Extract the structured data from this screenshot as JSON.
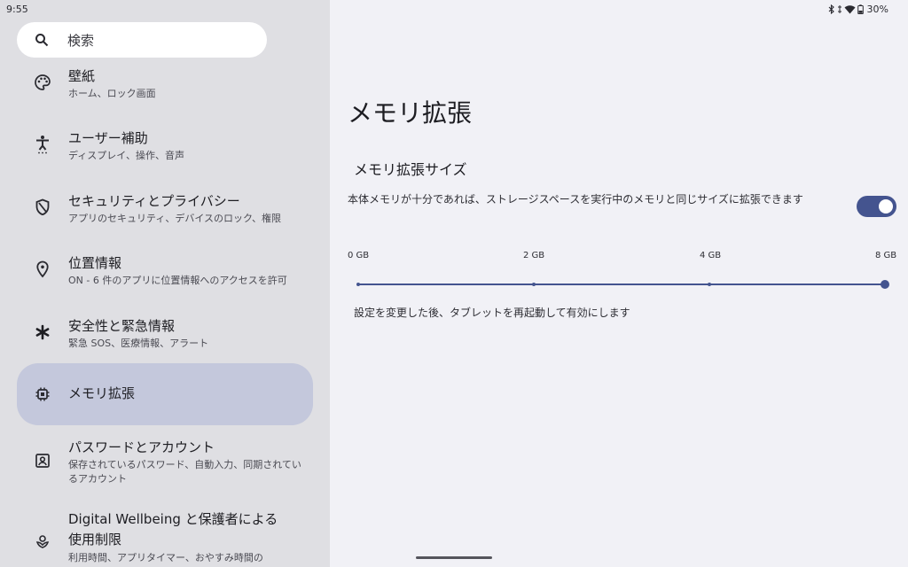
{
  "status": {
    "time": "9:55",
    "battery": "30%"
  },
  "search": {
    "placeholder": "検索"
  },
  "sidebar": {
    "items": [
      {
        "title": "壁紙",
        "sub": "ホーム、ロック画面",
        "icon": "palette-icon"
      },
      {
        "title": "ユーザー補助",
        "sub": "ディスプレイ、操作、音声",
        "icon": "accessibility-icon"
      },
      {
        "title": "セキュリティとプライバシー",
        "sub": "アプリのセキュリティ、デバイスのロック、権限",
        "icon": "shield-icon"
      },
      {
        "title": "位置情報",
        "sub": "ON - 6 件のアプリに位置情報へのアクセスを許可",
        "icon": "location-pin-icon"
      },
      {
        "title": "安全性と緊急情報",
        "sub": "緊急 SOS、医療情報、アラート",
        "icon": "asterisk-icon"
      },
      {
        "title": "メモリ拡張",
        "sub": "",
        "icon": "chip-icon"
      },
      {
        "title": "パスワードとアカウント",
        "sub": "保存されているパスワード、自動入力、同期されているアカウント",
        "icon": "account-box-icon"
      },
      {
        "title": "Digital Wellbeing と保護者による使用制限",
        "sub": "利用時間、アプリタイマー、おやすみ時間の",
        "icon": "wellbeing-icon"
      }
    ]
  },
  "main": {
    "title": "メモリ拡張",
    "section_title": "メモリ拡張サイズ",
    "description": "本体メモリが十分であれば、ストレージスペースを実行中のメモリと同じサイズに拡張できます",
    "toggle_on": true,
    "slider": {
      "ticks": [
        "0 GB",
        "2 GB",
        "4 GB",
        "8 GB"
      ],
      "selected_index": 3
    },
    "note": "設定を変更した後、タブレットを再起動して有効にします"
  },
  "colors": {
    "accent": "#44548f",
    "active_item": "#c4c8dc",
    "sidebar_bg": "#dfdfe3",
    "main_bg": "#f1f1f6"
  }
}
